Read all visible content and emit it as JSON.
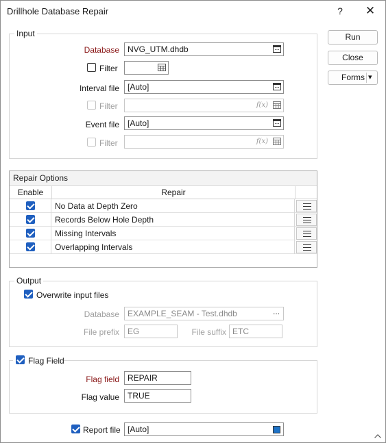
{
  "window": {
    "title": "Drillhole Database Repair",
    "help_glyph": "?",
    "close_glyph": "✕"
  },
  "buttons": {
    "run": "Run",
    "close": "Close",
    "forms": "Forms",
    "forms_arrow": "▾"
  },
  "input": {
    "legend": "Input",
    "database_label": "Database",
    "database_value": "NVG_UTM.dhdb",
    "filter_label": "Filter",
    "filter_checked": false,
    "interval_label": "Interval file",
    "interval_value": "[Auto]",
    "interval_filter_label": "Filter",
    "event_label": "Event file",
    "event_value": "[Auto]",
    "event_filter_label": "Filter",
    "fx_glyph": "f(x)"
  },
  "repair_options": {
    "title": "Repair Options",
    "col_enable": "Enable",
    "col_repair": "Repair",
    "rows": [
      {
        "label": "No Data at Depth Zero",
        "enabled": true
      },
      {
        "label": "Records Below Hole Depth",
        "enabled": true
      },
      {
        "label": "Missing Intervals",
        "enabled": true
      },
      {
        "label": "Overlapping Intervals",
        "enabled": true
      }
    ]
  },
  "output": {
    "legend": "Output",
    "overwrite_label": "Overwrite input files",
    "overwrite_checked": true,
    "database_label": "Database",
    "database_value": "EXAMPLE_SEAM - Test.dhdb",
    "browse_glyph": "...",
    "prefix_label": "File prefix",
    "prefix_value": "EG",
    "suffix_label": "File suffix",
    "suffix_value": "ETC"
  },
  "flag": {
    "legend": "Flag Field",
    "checked": true,
    "field_label": "Flag field",
    "field_value": "REPAIR",
    "value_label": "Flag value",
    "value_value": "TRUE"
  },
  "report": {
    "label": "Report file",
    "checked": true,
    "value": "[Auto]",
    "swatch_color": "#1e73c8"
  },
  "colors": {
    "required_label": "#8b1a1a",
    "checkbox_on": "#1f5fbf"
  }
}
